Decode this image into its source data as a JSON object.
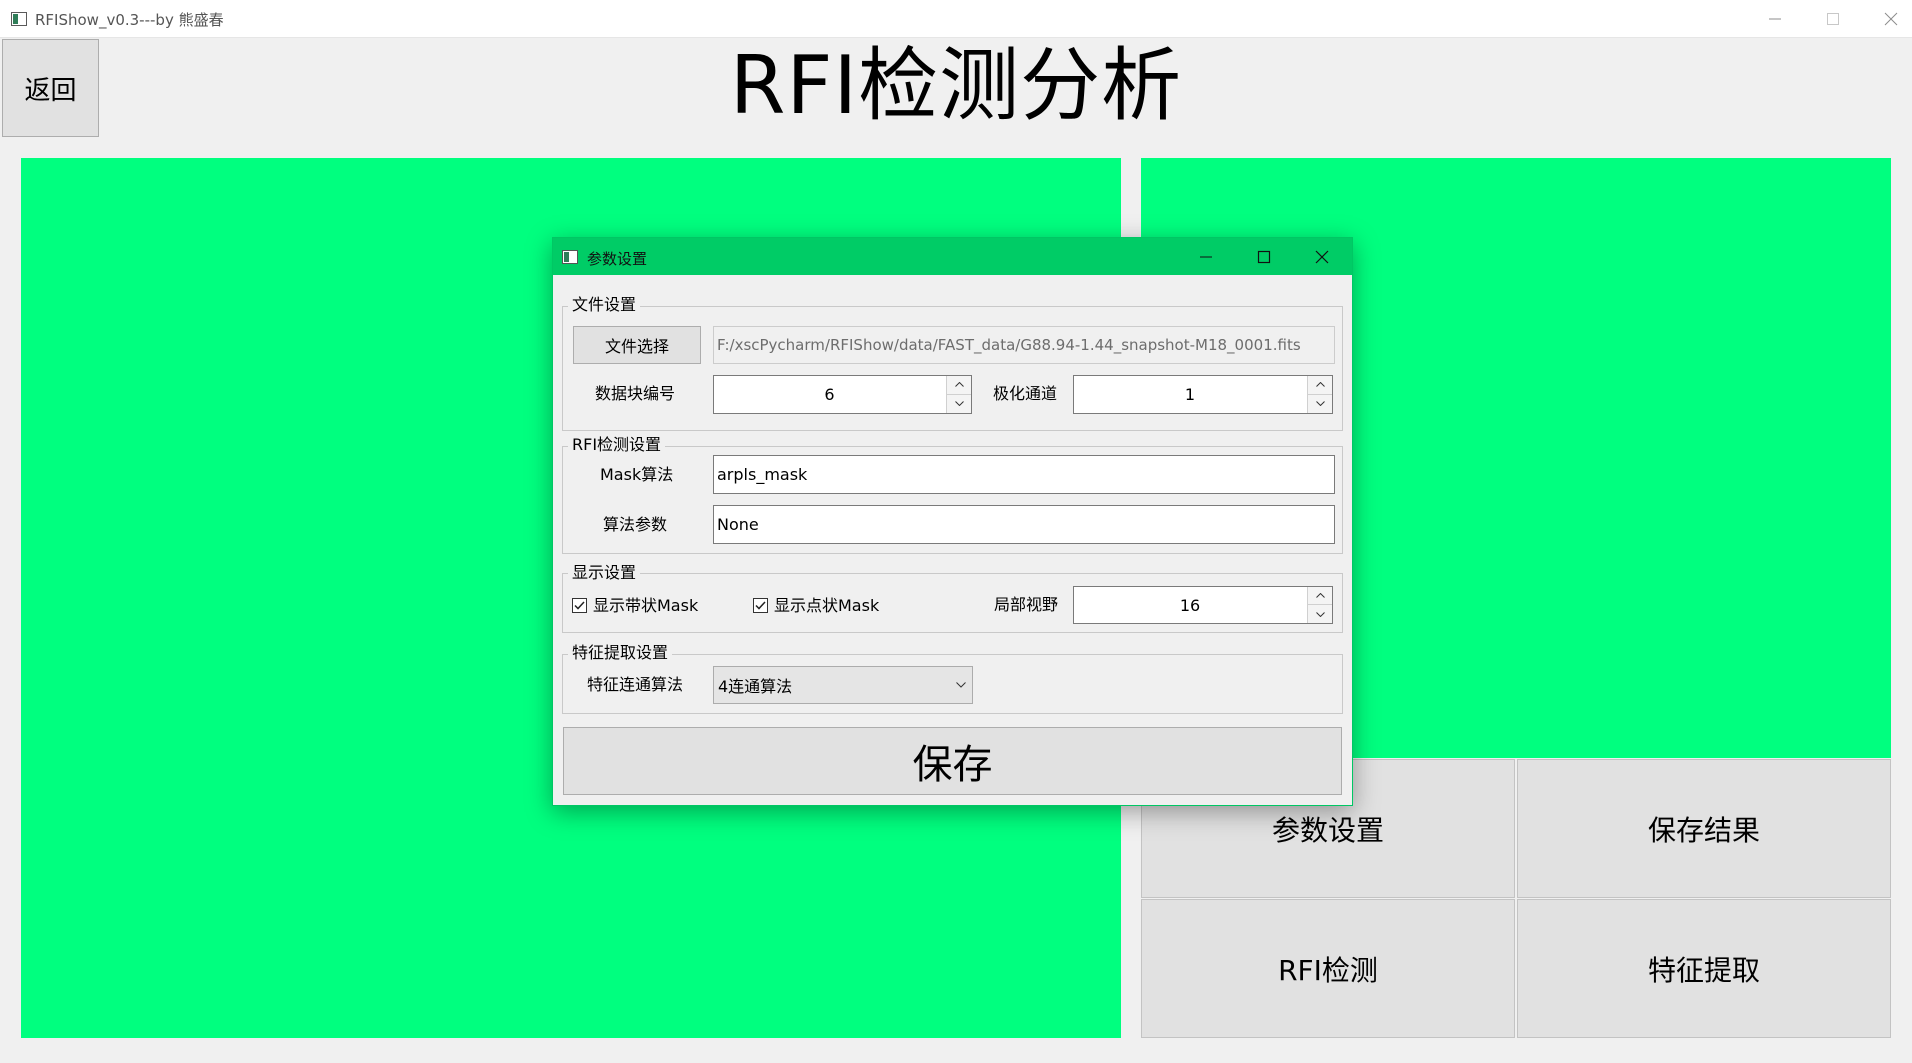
{
  "window": {
    "title": "RFIShow_v0.3---by 熊盛春"
  },
  "back_button": "返回",
  "page_title": "RFI检测分析",
  "actions": {
    "params": "参数设置",
    "save_result": "保存结果",
    "rfi_detect": "RFI检测",
    "feature_extract": "特征提取"
  },
  "dialog": {
    "title": "参数设置",
    "file_group": {
      "title": "文件设置",
      "file_button": "文件选择",
      "file_path": "F:/xscPycharm/RFIShow/data/FAST_data/G88.94-1.44_snapshot-M18_0001.fits",
      "block_label": "数据块编号",
      "block_value": "6",
      "pol_label": "极化通道",
      "pol_value": "1"
    },
    "rfi_group": {
      "title": "RFI检测设置",
      "mask_label": "Mask算法",
      "mask_value": "arpls_mask",
      "param_label": "算法参数",
      "param_value": "None"
    },
    "display_group": {
      "title": "显示设置",
      "band_mask_label": "显示带状Mask",
      "band_mask_checked": true,
      "point_mask_label": "显示点状Mask",
      "point_mask_checked": true,
      "local_view_label": "局部视野",
      "local_view_value": "16"
    },
    "feature_group": {
      "title": "特征提取设置",
      "conn_label": "特征连通算法",
      "conn_value": "4连通算法"
    },
    "save_button": "保存"
  },
  "colors": {
    "panel": "#00ff7f",
    "dialog_titlebar": "#00cc66"
  }
}
